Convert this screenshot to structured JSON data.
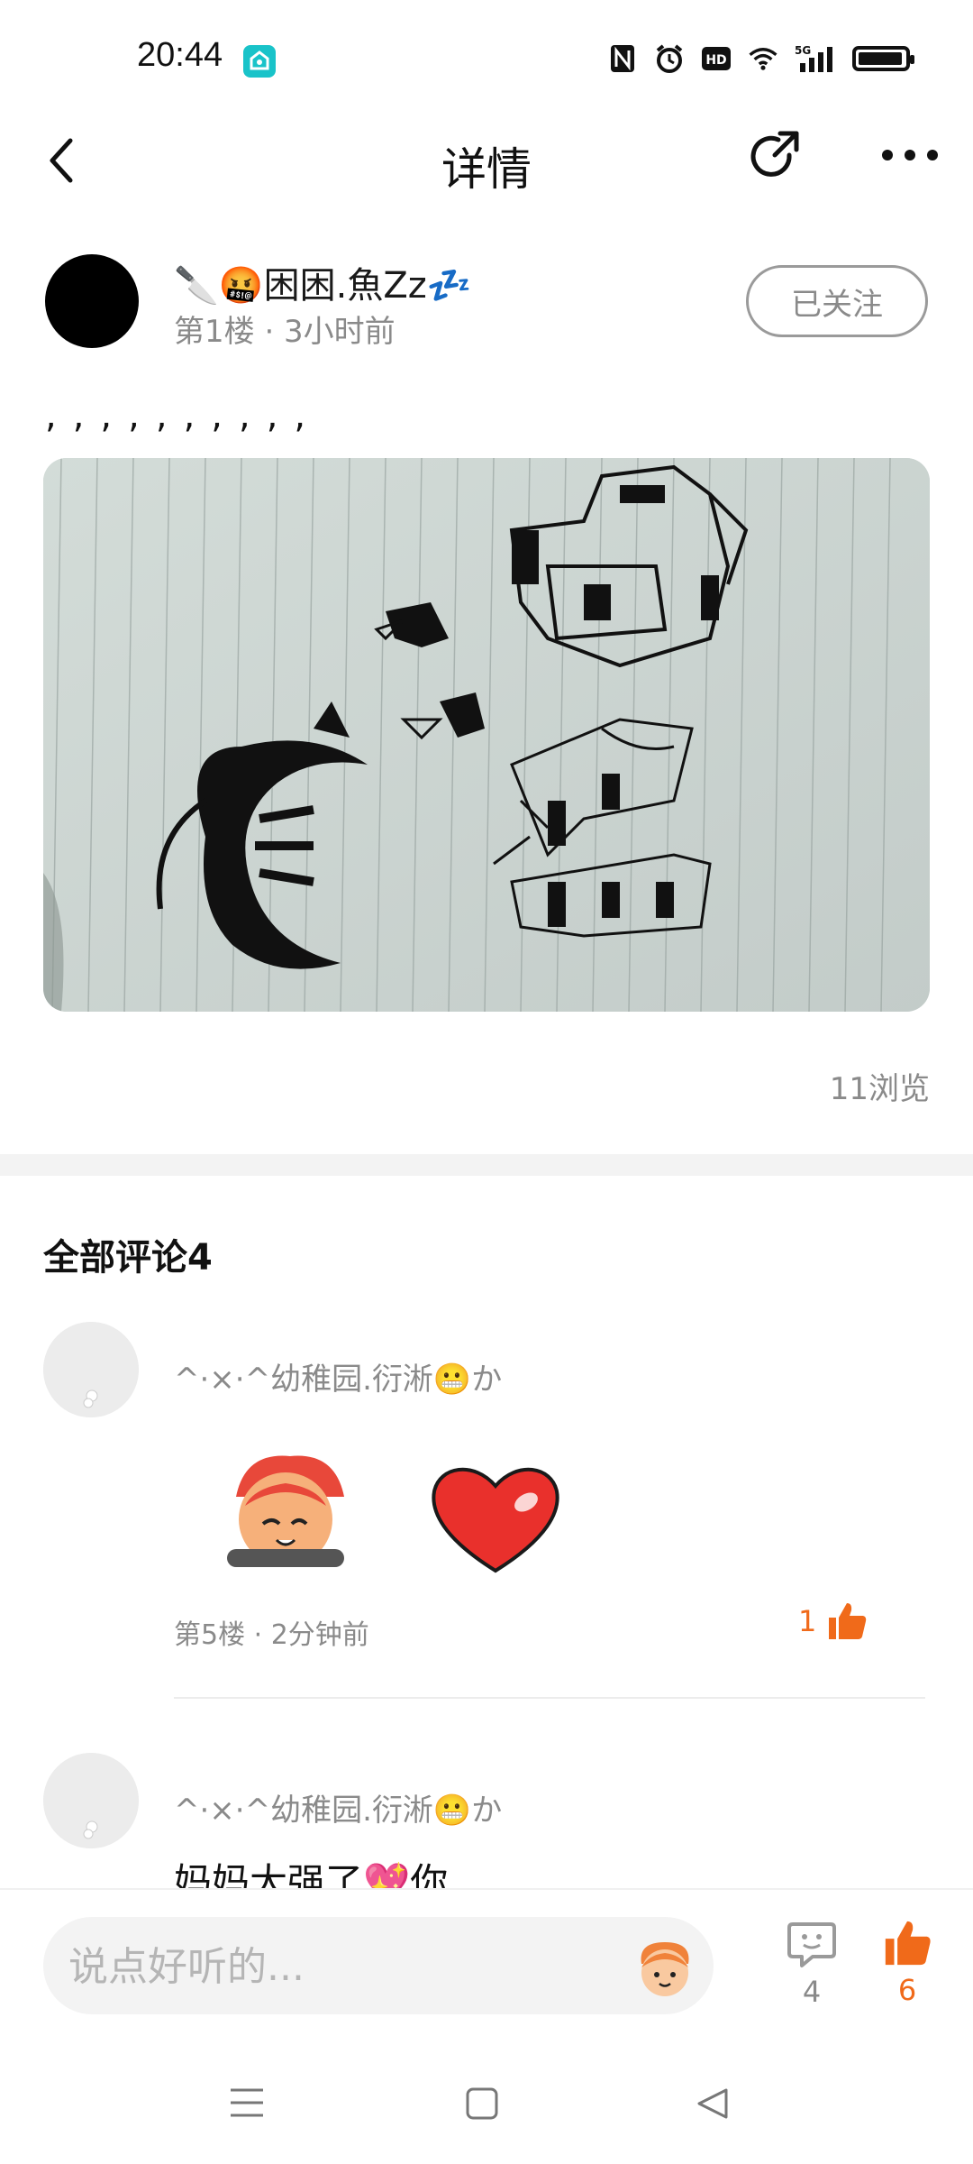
{
  "status_bar": {
    "time": "20:44",
    "network": "5G"
  },
  "header": {
    "title": "详情"
  },
  "post": {
    "author_name": "🔪🤬困困.魚Zz💤",
    "meta": "第1楼 · 3小时前",
    "follow_label": "已关注",
    "text": ",,,,,,,,,,",
    "views": "11浏览"
  },
  "comments_section": {
    "title": "全部评论4",
    "comments": [
      {
        "user": "^·×·^幼稚园.衍淅😬か",
        "meta": "第5楼 · 2分钟前",
        "likes": "1"
      },
      {
        "user": "^·×·^幼稚园.衍淅😬か",
        "text": "妈妈大强了💖你"
      }
    ]
  },
  "bottom_bar": {
    "input_placeholder": "说点好听的...",
    "comment_count": "4",
    "like_count": "6"
  },
  "colors": {
    "accent": "#f06a1a",
    "secondary_text": "#8a8a8a",
    "divider": "#f3f3f3"
  }
}
